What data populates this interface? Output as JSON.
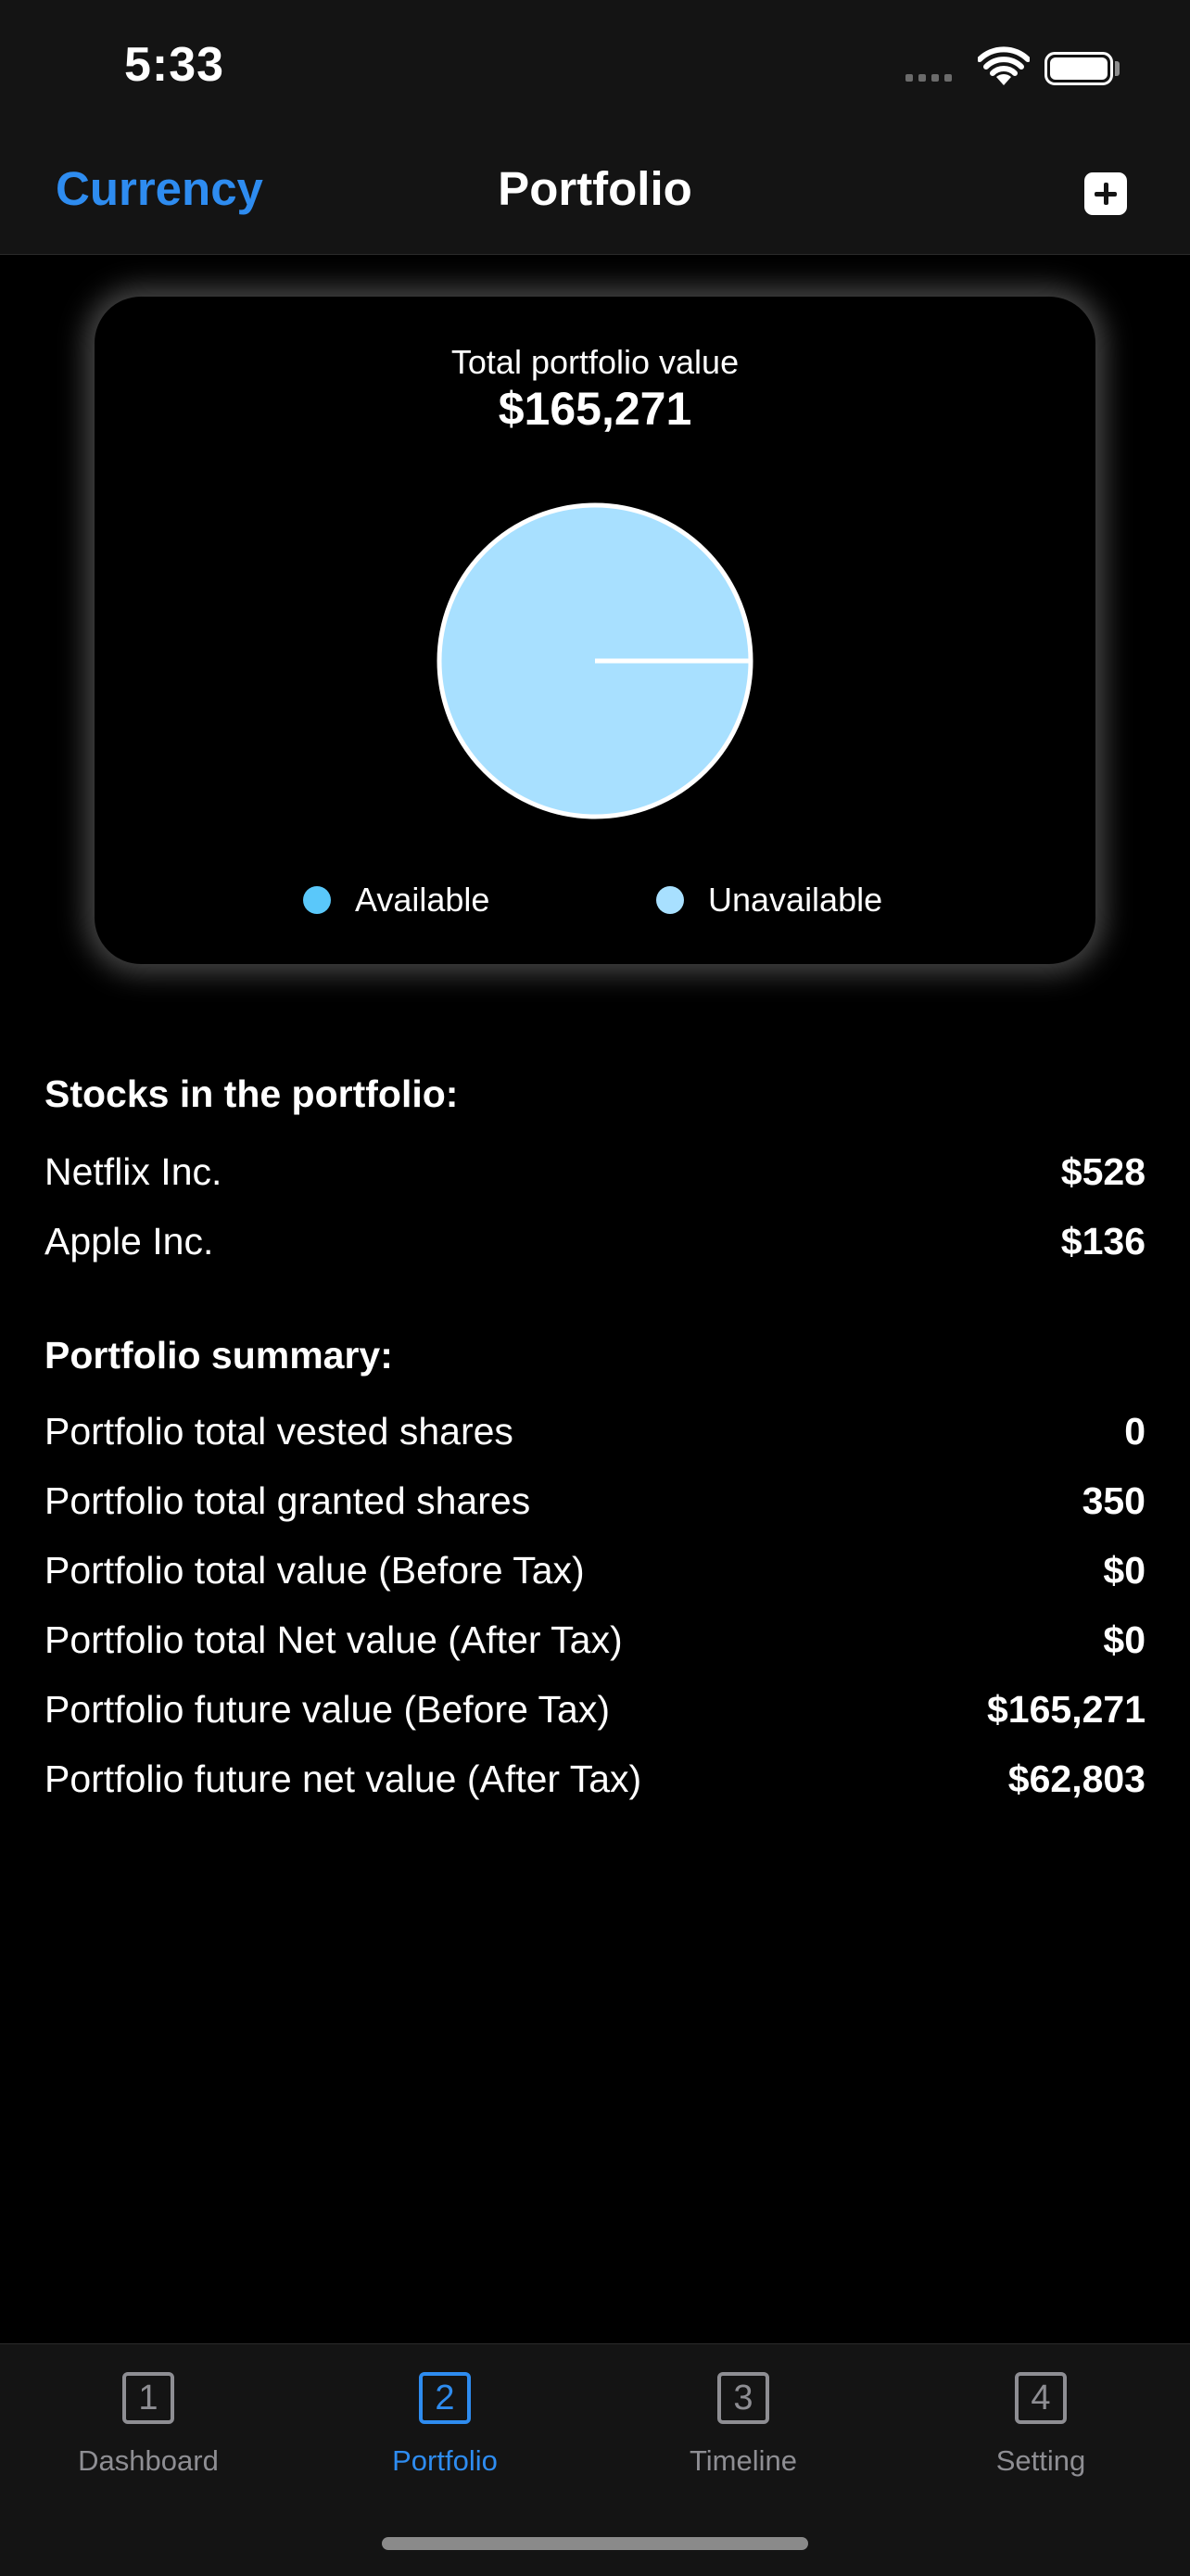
{
  "status_bar": {
    "time": "5:33"
  },
  "nav": {
    "left_label": "Currency",
    "title": "Portfolio",
    "add_icon": "plus-square-icon"
  },
  "card": {
    "label": "Total portfolio value",
    "value": "$165,271"
  },
  "chart_data": {
    "type": "pie",
    "slices": [
      {
        "name": "Available",
        "value": 0,
        "color": "#5ac8fa"
      },
      {
        "name": "Unavailable",
        "value": 100,
        "color": "#a8e0ff"
      }
    ],
    "legend_position": "bottom"
  },
  "stocks": {
    "title": "Stocks in the portfolio:",
    "items": [
      {
        "label": "Netflix Inc.",
        "value": "$528"
      },
      {
        "label": "Apple Inc.",
        "value": "$136"
      }
    ]
  },
  "summary": {
    "title": "Portfolio summary:",
    "items": [
      {
        "label": "Portfolio total vested shares",
        "value": "0"
      },
      {
        "label": "Portfolio total granted shares",
        "value": "350"
      },
      {
        "label": "Portfolio total value (Before Tax)",
        "value": "$0"
      },
      {
        "label": "Portfolio total Net value (After Tax)",
        "value": "$0"
      },
      {
        "label": "Portfolio future value (Before Tax)",
        "value": "$165,271"
      },
      {
        "label": "Portfolio future net value (After Tax)",
        "value": "$62,803"
      }
    ]
  },
  "tabs": [
    {
      "number": "1",
      "label": "Dashboard",
      "active": false
    },
    {
      "number": "2",
      "label": "Portfolio",
      "active": true
    },
    {
      "number": "3",
      "label": "Timeline",
      "active": false
    },
    {
      "number": "4",
      "label": "Setting",
      "active": false
    }
  ],
  "colors": {
    "accent": "#2e8cf0",
    "inactive": "#8e8e93",
    "bar_background": "#141414"
  }
}
